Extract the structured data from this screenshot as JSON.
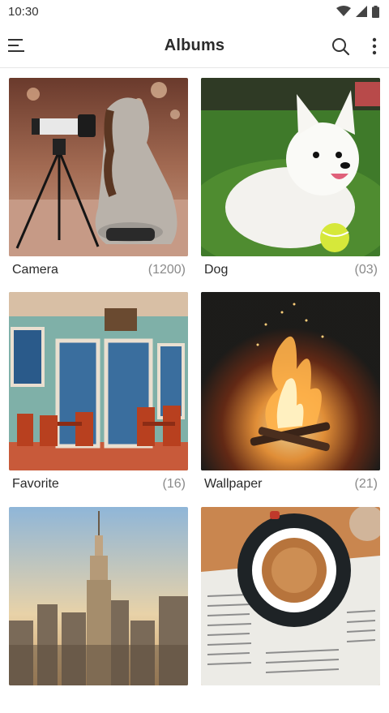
{
  "status": {
    "time": "10:30"
  },
  "appbar": {
    "title": "Albums"
  },
  "albums": [
    {
      "name": "Camera",
      "count": "(1200)"
    },
    {
      "name": "Dog",
      "count": "(03)"
    },
    {
      "name": "Favorite",
      "count": "(16)"
    },
    {
      "name": "Wallpaper",
      "count": "(21)"
    },
    {
      "name": "",
      "count": ""
    },
    {
      "name": "",
      "count": ""
    }
  ],
  "icons": [
    "wifi-icon",
    "signal-icon",
    "battery-icon",
    "menu-icon",
    "search-icon",
    "more-vert-icon"
  ]
}
